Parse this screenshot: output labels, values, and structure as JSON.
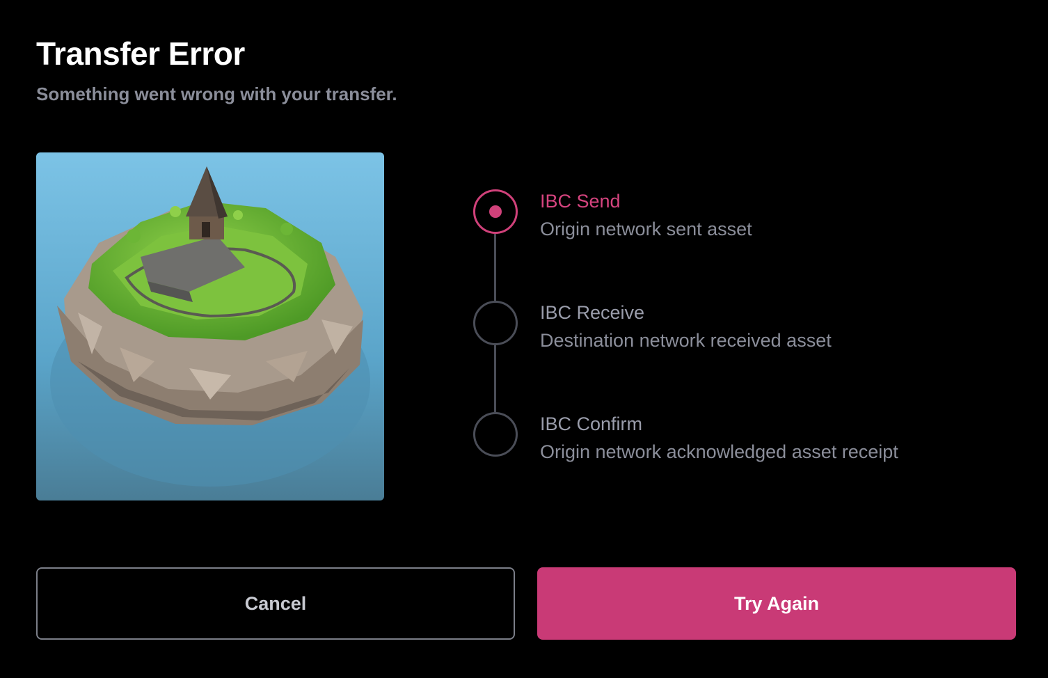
{
  "dialog": {
    "title": "Transfer Error",
    "subtitle": "Something went wrong with your transfer."
  },
  "colors": {
    "accent": "#c93a76",
    "inactive": "#4a4d57",
    "muted_text": "#8b8e9a"
  },
  "steps": [
    {
      "title": "IBC Send",
      "description": "Origin network sent asset",
      "status": "active"
    },
    {
      "title": "IBC Receive",
      "description": "Destination network received asset",
      "status": "pending"
    },
    {
      "title": "IBC Confirm",
      "description": "Origin network acknowledged asset receipt",
      "status": "pending"
    }
  ],
  "buttons": {
    "cancel_label": "Cancel",
    "retry_label": "Try Again"
  }
}
